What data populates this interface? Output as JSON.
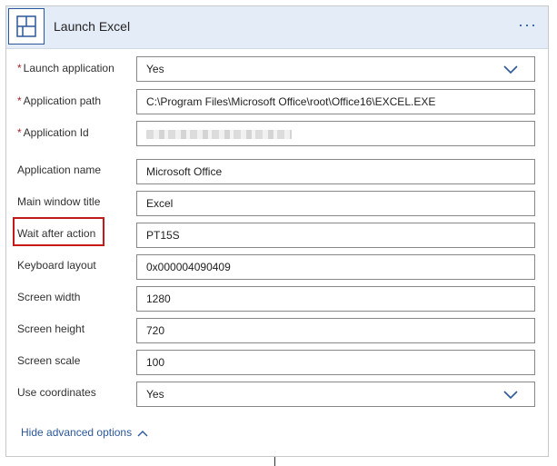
{
  "header": {
    "title": "Launch Excel",
    "more_label": "···"
  },
  "fields": [
    {
      "label": "Launch application",
      "required": true,
      "value": "Yes",
      "type": "dropdown"
    },
    {
      "label": "Application path",
      "required": true,
      "value": "C:\\Program Files\\Microsoft Office\\root\\Office16\\EXCEL.EXE",
      "type": "text"
    },
    {
      "label": "Application Id",
      "required": true,
      "value": "",
      "type": "redacted"
    },
    {
      "label": "Application name",
      "required": false,
      "value": "Microsoft Office",
      "type": "text"
    },
    {
      "label": "Main window title",
      "required": false,
      "value": "Excel",
      "type": "text"
    },
    {
      "label": "Wait after action",
      "required": false,
      "value": "PT15S",
      "type": "text"
    },
    {
      "label": "Keyboard layout",
      "required": false,
      "value": "0x000004090409",
      "type": "text"
    },
    {
      "label": "Screen width",
      "required": false,
      "value": "1280",
      "type": "text"
    },
    {
      "label": "Screen height",
      "required": false,
      "value": "720",
      "type": "text"
    },
    {
      "label": "Screen scale",
      "required": false,
      "value": "100",
      "type": "text"
    },
    {
      "label": "Use coordinates",
      "required": false,
      "value": "Yes",
      "type": "dropdown"
    }
  ],
  "required_marker": "*",
  "advanced_link": "Hide advanced options",
  "colors": {
    "accent": "#2b579a",
    "header_bg": "#e4ecf8",
    "required": "#a4262c",
    "highlight": "#c41a1a"
  },
  "icons": {
    "header": "layout-grid-icon",
    "dropdown": "chevron-down-icon",
    "advanced": "chevron-up-icon"
  }
}
